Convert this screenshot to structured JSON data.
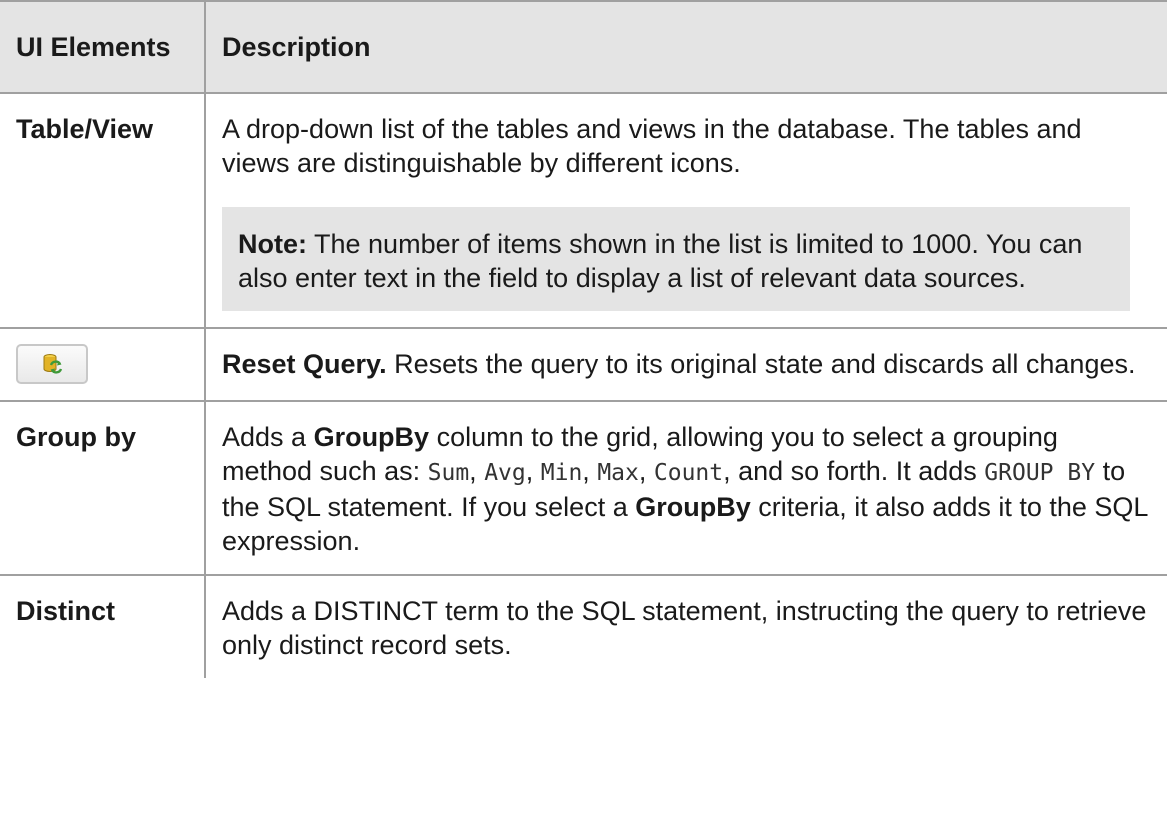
{
  "header": {
    "col1": "UI Elements",
    "col2": "Description"
  },
  "rows": [
    {
      "element": "Table/View",
      "description": "A drop-down list of the tables and views in the database. The tables and views are distinguishable by different icons.",
      "note_label": "Note:",
      "note_text": " The number of items shown in the list is limited to 1000. You can also enter text in the field to display a list of relevant data sources."
    },
    {
      "icon": "reset-query-icon",
      "title": "Reset Query.",
      "description": " Resets the query to its original state and discards all changes."
    },
    {
      "element": "Group by",
      "text_a": "Adds a ",
      "bold_a": "GroupBy",
      "text_b": " column to the grid, allowing you to select a grouping method such as: ",
      "code_sum": "Sum",
      "sep1": ", ",
      "code_avg": "Avg",
      "sep2": ", ",
      "code_min": "Min",
      "sep3": ", ",
      "code_max": "Max",
      "sep4": ", ",
      "code_count": "Count",
      "text_c": ", and so forth. It adds ",
      "code_groupby": "GROUP BY",
      "text_d": " to the SQL statement. If you select a ",
      "bold_b": "GroupBy",
      "text_e": " criteria, it also adds it to the SQL expression."
    },
    {
      "element": "Distinct",
      "description": "Adds a DISTINCT term to the SQL statement, instructing the query to retrieve only distinct record sets."
    }
  ],
  "colors": {
    "header_bg": "#e4e4e4",
    "note_bg": "#e4e4e4",
    "border": "#a0a0a0",
    "icon_yellow": "#e2b327",
    "icon_green": "#3f9a3a"
  }
}
